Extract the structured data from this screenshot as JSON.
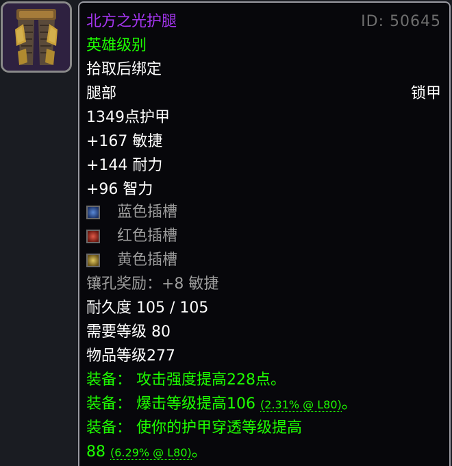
{
  "item": {
    "name": "北方之光护腿",
    "id_label": "ID: 50645",
    "quality": "英雄级别",
    "binding": "拾取后绑定",
    "slot": "腿部",
    "armor_type": "锁甲",
    "armor": "1349点护甲",
    "stats": [
      "+167 敏捷",
      "+144 耐力",
      "+96 智力"
    ],
    "sockets": [
      {
        "label": "蓝色插槽",
        "color": "#3a5fa8"
      },
      {
        "label": "红色插槽",
        "color": "#b0362c"
      },
      {
        "label": "黄色插槽",
        "color": "#b89a3a"
      }
    ],
    "socket_bonus": "镶孔奖励：+8 敏捷",
    "durability": "耐久度 105 / 105",
    "required_level": "需要等级 80",
    "item_level": "物品等级277",
    "equip": [
      {
        "prefix": "装备：",
        "text": "攻击强度提高228点。",
        "detail": "",
        "suffix": ""
      },
      {
        "prefix": "装备：",
        "text": "爆击等级提高106",
        "detail": "(2.31% @ L80)",
        "suffix": "。"
      },
      {
        "prefix": "装备：",
        "text": "使你的护甲穿透等级提高",
        "text2": "88",
        "detail": "(6.29% @ L80)",
        "suffix": "。"
      }
    ]
  },
  "colors": {
    "epic": "#a335ee",
    "uncommon": "#1eff00",
    "grey": "#9d9d9d",
    "background": "#07070b"
  },
  "icon": "mail-leggings-icon"
}
